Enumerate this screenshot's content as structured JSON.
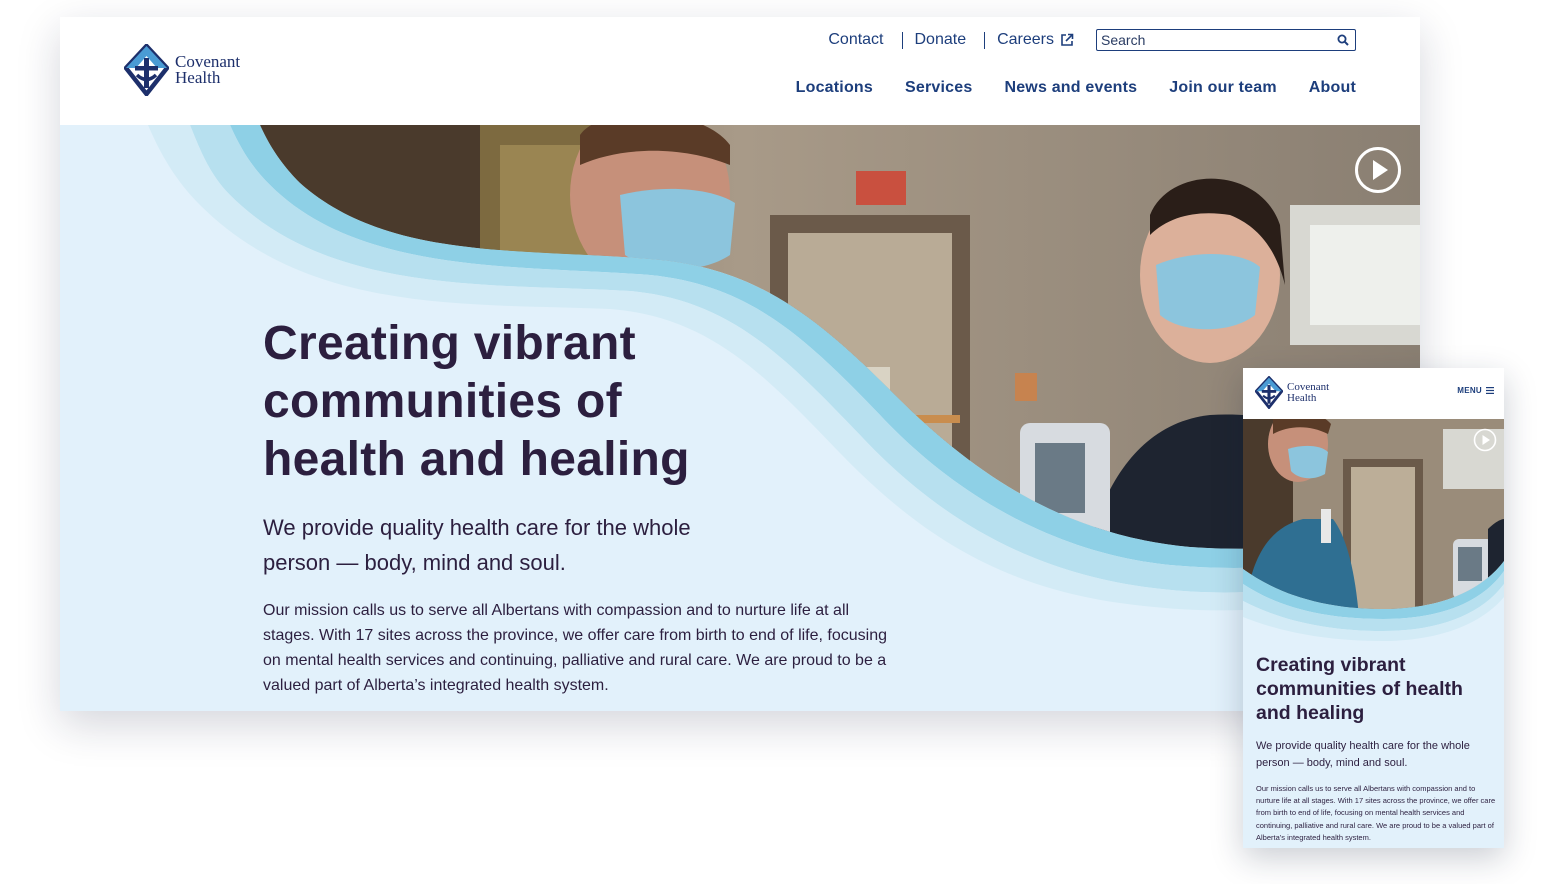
{
  "brand": {
    "name_line1": "Covenant",
    "name_line2": "Health",
    "colors": {
      "navy": "#1d2f6b",
      "link": "#1d3e7c",
      "accent_blue": "#4a9bd4",
      "heading": "#2c1f3f",
      "hero_bg": "#e2f1fb",
      "wave": "#8ed0e6"
    }
  },
  "desktop": {
    "utility_nav": {
      "contact": "Contact",
      "donate": "Donate",
      "careers": "Careers",
      "careers_icon": "external-link-icon"
    },
    "search": {
      "placeholder": "Search",
      "icon": "search-icon"
    },
    "main_nav": [
      "Locations",
      "Services",
      "News and events",
      "Join our team",
      "About"
    ],
    "hero": {
      "title": "Creating vibrant communities of health and healing",
      "subtitle": "We provide quality health care for the whole person — body, mind and soul.",
      "body": "Our mission calls us to serve all Albertans with compassion and to nurture life at all stages. With 17 sites across the province, we offer care from birth to end of life, focusing on mental health services and continuing, palliative and rural care. We are proud to be a valued part of Alberta’s integrated health system.",
      "play_icon": "play-circle-icon"
    }
  },
  "mobile": {
    "menu_label": "MENU",
    "menu_icon": "hamburger-icon",
    "hero": {
      "title": "Creating vibrant communities of health and healing",
      "subtitle": "We provide quality health care for the whole person — body, mind and soul.",
      "body": "Our mission calls us to serve all Albertans with compassion and to nurture life at all stages. With 17 sites across the province, we offer care from birth to end of life, focusing on mental health services and continuing, palliative and rural care. We are proud to be a valued part of Alberta’s integrated health system.",
      "play_icon": "play-circle-icon"
    }
  }
}
